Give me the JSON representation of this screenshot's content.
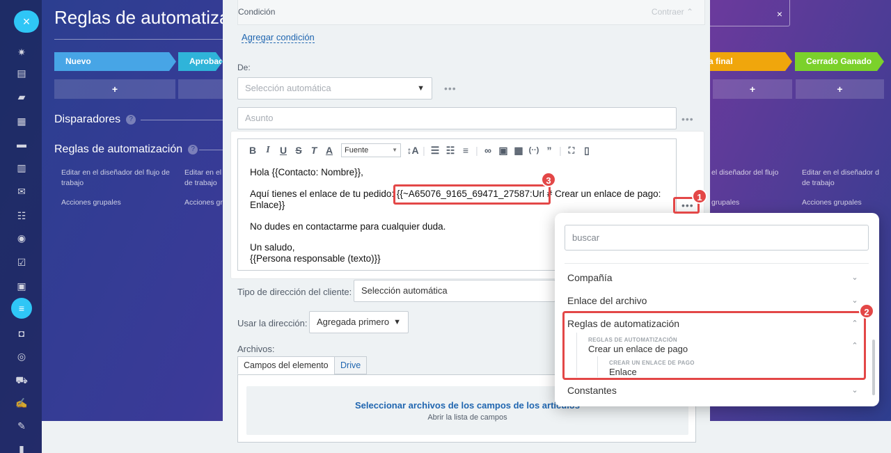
{
  "sidebar": {
    "close": "×"
  },
  "background": {
    "title": "Reglas de automatizació",
    "stages": [
      {
        "label": "Nuevo",
        "color": "#47a5e6"
      },
      {
        "label": "Aprobac",
        "color": "#2fb4d9"
      },
      {
        "label": "a final",
        "color": "#f0a60c"
      },
      {
        "label": "Cerrado Ganado",
        "color": "#7bd12b"
      }
    ],
    "plus": "+",
    "triggers": "Disparadores",
    "rules": "Reglas de automatización",
    "help": "?",
    "edit_link": "Editar en el diseñador del flujo de trabajo",
    "edit_link_short": "Editar en el",
    "edit_link_short2": "de trabajo",
    "edit_link_right": "el diseñador del flujo",
    "edit_link_right2": "Editar en el diseñador d",
    "group_actions": "Acciones grupales",
    "group_actions_short": "Acciones gr",
    "group_actions_right": "grupales",
    "x_close": "×"
  },
  "panel": {
    "condition_label": "Condición",
    "collapse": "Contraer",
    "add_condition": "Agregar condición",
    "from_label": "De:",
    "from_value": "Selección automática",
    "subject_placeholder": "Asunto",
    "editor": {
      "font_label": "Fuente",
      "line1": "Hola {{Contacto: Nombre}},",
      "line2a": "Aquí tienes el enlace de tu pedido: ",
      "line2b": "{{~A65076_9165_69471_27587:Url # Crear un enlace de pago:",
      "line3": "Enlace}}",
      "line4": "No dudes en contactarme para cualquier duda.",
      "line5": "Un saludo,",
      "line6": "{{Persona responsable (texto)}}"
    },
    "address_type_label": "Tipo de dirección del cliente:",
    "address_type_value": "Selección automática",
    "use_address_label": "Usar la dirección:",
    "use_address_value": "Agregada primero",
    "files_label": "Archivos:",
    "tab_fields": "Campos del elemento",
    "tab_drive": "Drive",
    "select_files": "Seleccionar archivos de los campos de los artículos",
    "open_list": "Abrir la lista de campos"
  },
  "popup": {
    "search_placeholder": "buscar",
    "items": {
      "company": "Compañía",
      "file_link": "Enlace del archivo",
      "rules": "Reglas de automatización",
      "rules_caption": "REGLAS DE AUTOMATIZACIÓN",
      "payment_link": "Crear un enlace de pago",
      "payment_caption": "CREAR UN ENLACE DE PAGO",
      "link": "Enlace",
      "constants": "Constantes"
    }
  },
  "badges": {
    "one": "1",
    "two": "2",
    "three": "3"
  },
  "accent": "#e34747"
}
